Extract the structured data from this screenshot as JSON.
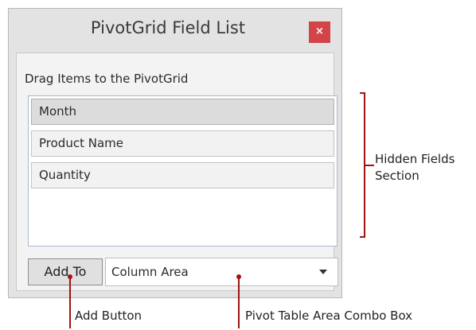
{
  "window": {
    "title": "PivotGrid Field List",
    "close_glyph": "×"
  },
  "panel": {
    "label": "Drag Items to the PivotGrid",
    "fields": [
      "Month",
      "Product Name",
      "Quantity"
    ]
  },
  "controls": {
    "add_button_label": "Add To",
    "area_combo_value": "Column Area"
  },
  "annotations": {
    "hidden_fields_line1": "Hidden Fields",
    "hidden_fields_line2": "Section",
    "add_button": "Add Button",
    "area_combo": "Pivot Table Area Combo Box"
  },
  "colors": {
    "annotation_line": "#a01414",
    "close_button": "#d24448"
  }
}
